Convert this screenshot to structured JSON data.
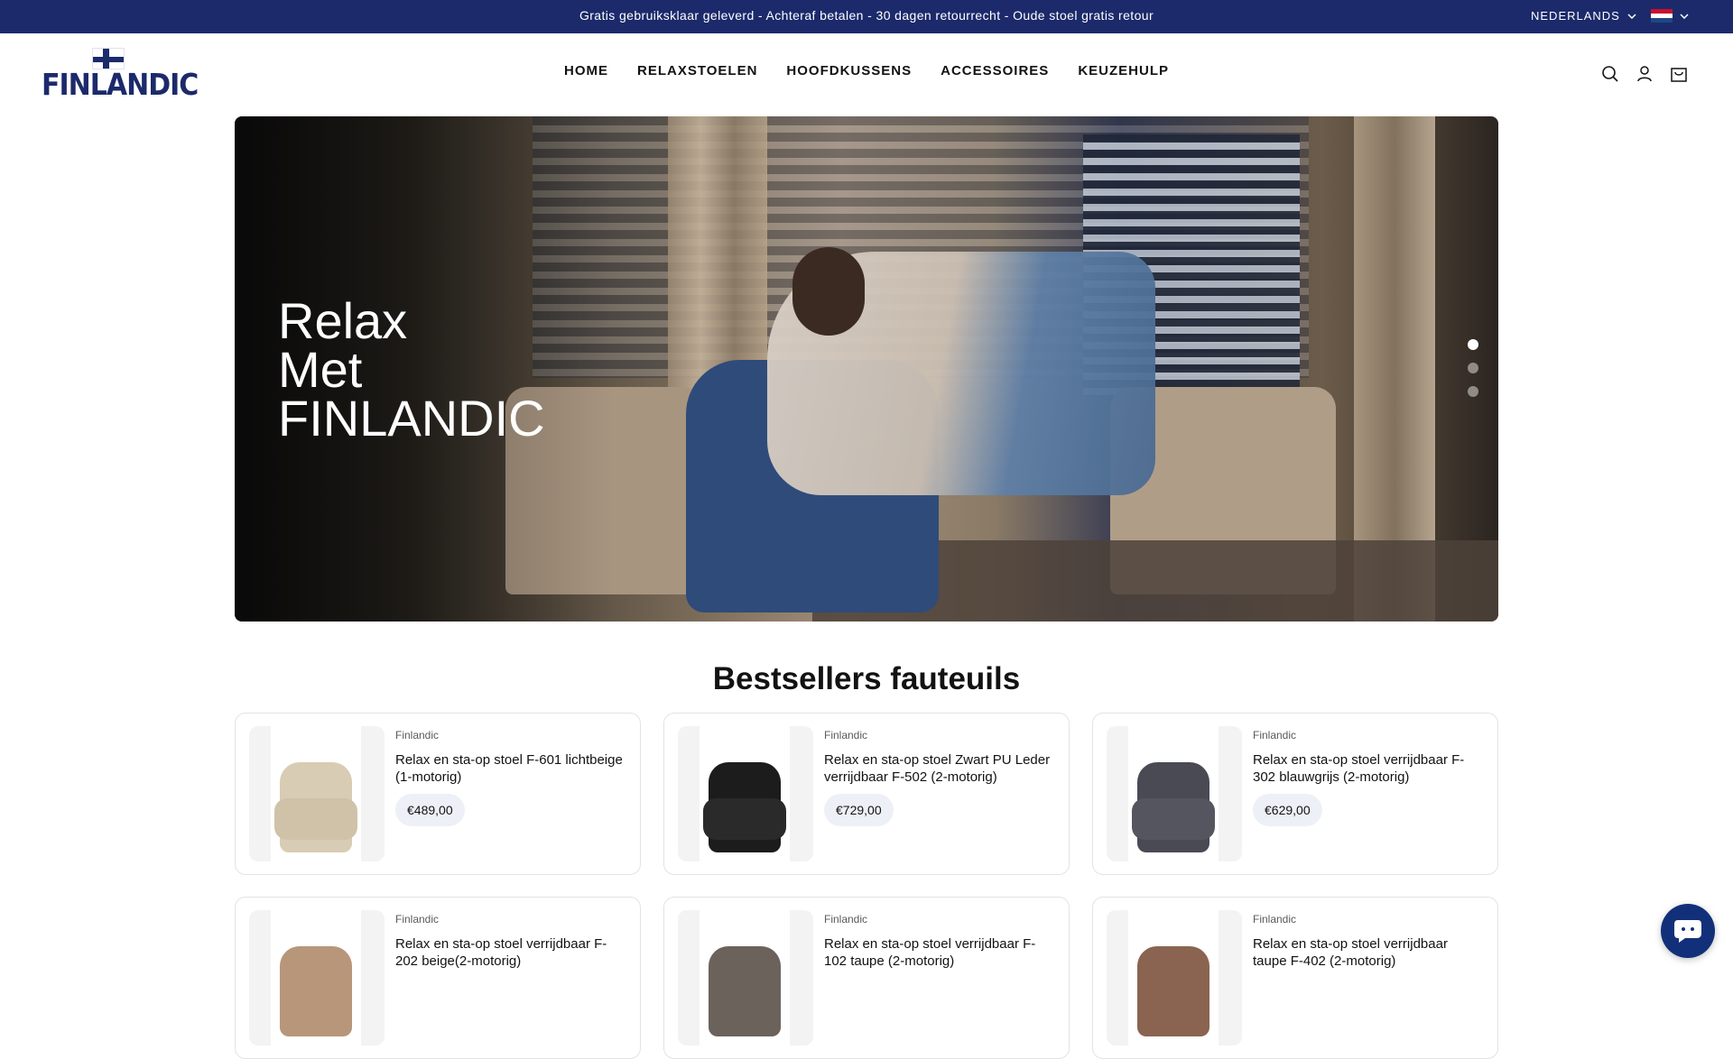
{
  "announcement": {
    "text": "Gratis gebruiksklaar geleverd - Achteraf betalen - 30 dagen retourrecht - Oude stoel gratis retour",
    "language": "NEDERLANDS",
    "colors": {
      "bar": "#1c2a6b"
    }
  },
  "header": {
    "logo_text": "FINLANDIC",
    "nav": [
      "HOME",
      "RELAXSTOELEN",
      "HOOFDKUSSENS",
      "ACCESSOIRES",
      "KEUZEHULP"
    ],
    "icons": [
      "search-icon",
      "account-icon",
      "cart-icon"
    ]
  },
  "hero": {
    "title_lines": [
      "Relax",
      "Met",
      "FINLANDIC"
    ],
    "slides": 3,
    "active_slide": 1
  },
  "bestsellers": {
    "title": "Bestsellers fauteuils",
    "products": [
      {
        "brand": "Finlandic",
        "name": "Relax en sta-op stoel F-601 lichtbeige (1-motorig)",
        "price": "€489,00",
        "color": "#d8ccb4"
      },
      {
        "brand": "Finlandic",
        "name": "Relax en sta-op stoel Zwart PU Leder verrijdbaar F-502 (2-motorig)",
        "price": "€729,00",
        "color": "#1c1c1c"
      },
      {
        "brand": "Finlandic",
        "name": "Relax en sta-op stoel verrijdbaar F-302 blauwgrijs (2-motorig)",
        "price": "€629,00",
        "color": "#4a4a55"
      },
      {
        "brand": "Finlandic",
        "name": "Relax en sta-op stoel verrijdbaar F-202 beige(2-motorig)",
        "price": "",
        "color": "#b8967a"
      },
      {
        "brand": "Finlandic",
        "name": "Relax en sta-op stoel verrijdbaar F-102 taupe (2-motorig)",
        "price": "",
        "color": "#6b625c"
      },
      {
        "brand": "Finlandic",
        "name": "Relax en sta-op stoel verrijdbaar taupe F-402 (2-motorig)",
        "price": "",
        "color": "#8a6450"
      }
    ]
  },
  "chat": {
    "icon": "chat-icon"
  }
}
